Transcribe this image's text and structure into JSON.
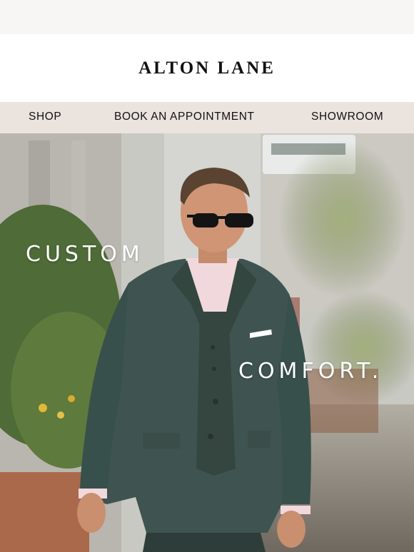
{
  "brand": {
    "logo_text": "ALTON LANE"
  },
  "nav": {
    "items": [
      {
        "label": "SHOP"
      },
      {
        "label": "BOOK AN APPOINTMENT"
      },
      {
        "label": "SHOWROOM"
      }
    ]
  },
  "hero": {
    "headline_left": "CUSTOM",
    "headline_right": "COMFORT."
  },
  "colors": {
    "nav_background": "#ebe3de",
    "suit_green": "#3f5450",
    "text_dark": "#111111"
  }
}
